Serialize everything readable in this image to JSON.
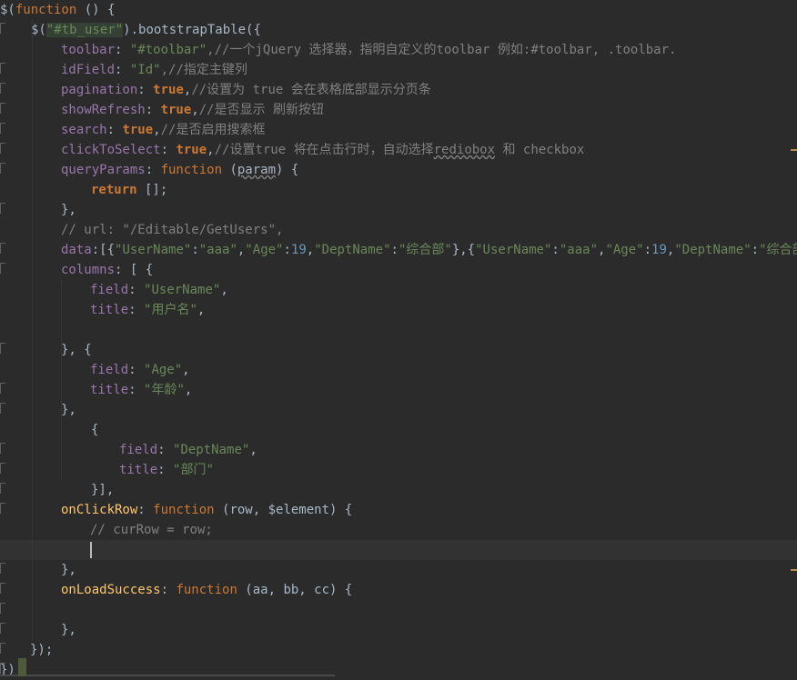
{
  "editor": {
    "lines": [
      {
        "segments": [
          {
            "t": "$(",
            "c": ""
          },
          {
            "t": "function",
            "c": "k2"
          },
          {
            "t": " () {",
            "c": ""
          }
        ]
      },
      {
        "segments": [
          {
            "t": "$(",
            "c": ""
          },
          {
            "t": "\"#tb_user\"",
            "c": "s hl"
          },
          {
            "t": ").bootstrapTable({",
            "c": ""
          }
        ]
      },
      {
        "segments": [
          {
            "t": "toolbar",
            "c": "p"
          },
          {
            "t": ": ",
            "c": ""
          },
          {
            "t": "\"#toolbar\"",
            "c": "s"
          },
          {
            "t": ",//一个jQuery 选择器，指明自定义的toolbar 例如:#toolbar, .toolbar.",
            "c": "c"
          }
        ]
      },
      {
        "segments": [
          {
            "t": "idField",
            "c": "p"
          },
          {
            "t": ": ",
            "c": ""
          },
          {
            "t": "\"Id\"",
            "c": "s"
          },
          {
            "t": ",//指定主键列",
            "c": "c"
          }
        ]
      },
      {
        "segments": [
          {
            "t": "pagination",
            "c": "p"
          },
          {
            "t": ": ",
            "c": ""
          },
          {
            "t": "true",
            "c": "k"
          },
          {
            "t": ",",
            "c": ""
          },
          {
            "t": "//设置为 true 会在表格底部显示分页条",
            "c": "c"
          }
        ]
      },
      {
        "segments": [
          {
            "t": "showRefresh",
            "c": "p"
          },
          {
            "t": ": ",
            "c": ""
          },
          {
            "t": "true",
            "c": "k"
          },
          {
            "t": ",",
            "c": ""
          },
          {
            "t": "//是否显示 刷新按钮",
            "c": "c"
          }
        ]
      },
      {
        "segments": [
          {
            "t": "search",
            "c": "p"
          },
          {
            "t": ": ",
            "c": ""
          },
          {
            "t": "true",
            "c": "k"
          },
          {
            "t": ",",
            "c": ""
          },
          {
            "t": "//是否启用搜索框",
            "c": "c"
          }
        ]
      },
      {
        "segments": [
          {
            "t": "clickToSelect",
            "c": "p"
          },
          {
            "t": ": ",
            "c": ""
          },
          {
            "t": "true",
            "c": "k"
          },
          {
            "t": ",",
            "c": ""
          },
          {
            "t": "//设置true 将在点击行时，自动选择",
            "c": "c"
          },
          {
            "t": "rediobox",
            "c": "c uline2"
          },
          {
            "t": " 和 checkbox",
            "c": "c"
          }
        ]
      },
      {
        "segments": [
          {
            "t": "queryParams",
            "c": "p"
          },
          {
            "t": ": ",
            "c": ""
          },
          {
            "t": "function",
            "c": "k2"
          },
          {
            "t": " (",
            "c": ""
          },
          {
            "t": "param",
            "c": "uline2"
          },
          {
            "t": ") {",
            "c": ""
          }
        ]
      },
      {
        "segments": [
          {
            "t": "return",
            "c": "k"
          },
          {
            "t": " [];",
            "c": ""
          }
        ]
      },
      {
        "segments": [
          {
            "t": "},",
            "c": ""
          }
        ]
      },
      {
        "segments": [
          {
            "t": "// url: \"/Editable/GetUsers\",",
            "c": "c"
          }
        ]
      },
      {
        "segments": [
          {
            "t": "data",
            "c": "p"
          },
          {
            "t": ":[{",
            "c": ""
          },
          {
            "t": "\"UserName\"",
            "c": "s"
          },
          {
            "t": ":",
            "c": ""
          },
          {
            "t": "\"aaa\"",
            "c": "s"
          },
          {
            "t": ",",
            "c": ""
          },
          {
            "t": "\"Age\"",
            "c": "s"
          },
          {
            "t": ":",
            "c": ""
          },
          {
            "t": "19",
            "c": "n"
          },
          {
            "t": ",",
            "c": ""
          },
          {
            "t": "\"DeptName\"",
            "c": "s"
          },
          {
            "t": ":",
            "c": ""
          },
          {
            "t": "\"综合部\"",
            "c": "s"
          },
          {
            "t": "},{",
            "c": ""
          },
          {
            "t": "\"UserName\"",
            "c": "s"
          },
          {
            "t": ":",
            "c": ""
          },
          {
            "t": "\"aaa\"",
            "c": "s"
          },
          {
            "t": ",",
            "c": ""
          },
          {
            "t": "\"Age\"",
            "c": "s"
          },
          {
            "t": ":",
            "c": ""
          },
          {
            "t": "19",
            "c": "n"
          },
          {
            "t": ",",
            "c": ""
          },
          {
            "t": "\"DeptName\"",
            "c": "s"
          },
          {
            "t": ":",
            "c": ""
          },
          {
            "t": "\"综合部\"",
            "c": "s"
          },
          {
            "t": "}",
            "c": ""
          }
        ]
      },
      {
        "segments": [
          {
            "t": "columns",
            "c": "p"
          },
          {
            "t": ": [ {",
            "c": ""
          }
        ]
      },
      {
        "segments": [
          {
            "t": "field",
            "c": "p"
          },
          {
            "t": ": ",
            "c": ""
          },
          {
            "t": "\"UserName\"",
            "c": "s"
          },
          {
            "t": ",",
            "c": ""
          }
        ]
      },
      {
        "segments": [
          {
            "t": "title",
            "c": "p"
          },
          {
            "t": ": ",
            "c": ""
          },
          {
            "t": "\"用户名\"",
            "c": "s"
          },
          {
            "t": ",",
            "c": ""
          }
        ]
      },
      {
        "segments": []
      },
      {
        "segments": [
          {
            "t": "}, {",
            "c": ""
          }
        ]
      },
      {
        "segments": [
          {
            "t": "field",
            "c": "p"
          },
          {
            "t": ": ",
            "c": ""
          },
          {
            "t": "\"Age\"",
            "c": "s"
          },
          {
            "t": ",",
            "c": ""
          }
        ]
      },
      {
        "segments": [
          {
            "t": "title",
            "c": "p"
          },
          {
            "t": ": ",
            "c": ""
          },
          {
            "t": "\"年龄\"",
            "c": "s"
          },
          {
            "t": ",",
            "c": ""
          }
        ]
      },
      {
        "segments": [
          {
            "t": "},",
            "c": ""
          }
        ]
      },
      {
        "segments": [
          {
            "t": "{",
            "c": ""
          }
        ]
      },
      {
        "segments": [
          {
            "t": "field",
            "c": "p"
          },
          {
            "t": ": ",
            "c": ""
          },
          {
            "t": "\"DeptName\"",
            "c": "s"
          },
          {
            "t": ",",
            "c": ""
          }
        ]
      },
      {
        "segments": [
          {
            "t": "title",
            "c": "p"
          },
          {
            "t": ": ",
            "c": ""
          },
          {
            "t": "\"部门\"",
            "c": "s"
          }
        ]
      },
      {
        "segments": [
          {
            "t": "}],",
            "c": ""
          }
        ]
      },
      {
        "segments": [
          {
            "t": "onClickRow",
            "c": "f"
          },
          {
            "t": ": ",
            "c": ""
          },
          {
            "t": "function",
            "c": "k2"
          },
          {
            "t": " (row, $element) {",
            "c": ""
          }
        ]
      },
      {
        "segments": [
          {
            "t": "// curRow = row;",
            "c": "c"
          }
        ]
      },
      {
        "segments": []
      },
      {
        "segments": [
          {
            "t": "},",
            "c": ""
          }
        ]
      },
      {
        "segments": [
          {
            "t": "onLoadSuccess",
            "c": "f"
          },
          {
            "t": ": ",
            "c": ""
          },
          {
            "t": "function",
            "c": "k2"
          },
          {
            "t": " (aa, bb, cc) {",
            "c": ""
          }
        ]
      },
      {
        "segments": []
      },
      {
        "segments": [
          {
            "t": "},",
            "c": ""
          }
        ]
      },
      {
        "segments": [
          {
            "t": "});",
            "c": ""
          }
        ]
      },
      {
        "segments": [
          {
            "t": "})",
            "c": ""
          }
        ]
      }
    ]
  },
  "colors": {
    "background": "#2b2b2b",
    "current_line": "#323232",
    "keyword": "#cc7832",
    "string": "#6a8759",
    "number": "#6897bb",
    "property": "#9876aa",
    "comment": "#808080",
    "function_name": "#ffc66d",
    "default_text": "#a9b7c6",
    "highlight": "#344134"
  }
}
